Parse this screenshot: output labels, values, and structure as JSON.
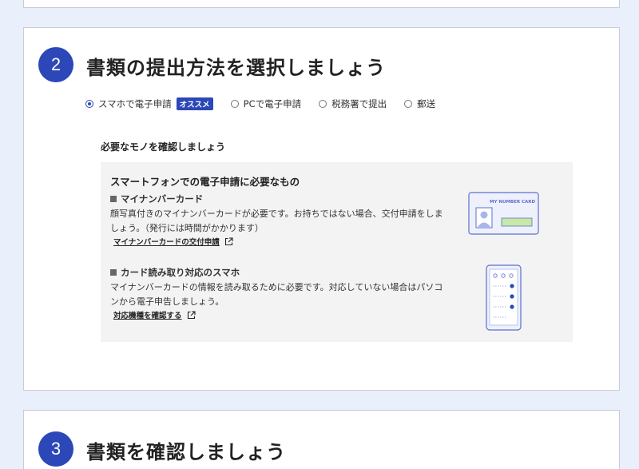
{
  "step2": {
    "number": "2",
    "title": "書類の提出方法を選択しましょう",
    "options": [
      {
        "label": "スマホで電子申請",
        "badge": "オススメ",
        "selected": true
      },
      {
        "label": "PCで電子申請",
        "selected": false
      },
      {
        "label": "税務署で提出",
        "selected": false
      },
      {
        "label": "郵送",
        "selected": false
      }
    ],
    "needs_title": "必要なモノを確認しましょう",
    "box_title": "スマートフォンでの電子申請に必要なもの",
    "items": [
      {
        "head": "マイナンバーカード",
        "desc": "顔写真付きのマイナンバーカードが必要です。お持ちではない場合、交付申請をしましょう。（発行には時間がかかります）",
        "link": "マイナンバーカードの交付申請",
        "illus_text": "MY NUMBER CARD"
      },
      {
        "head": "カード読み取り対応のスマホ",
        "desc": "マイナンバーカードの情報を読み取るために必要です。対応していない場合はパソコンから電子申告しましょう。",
        "link": "対応機種を確認する"
      }
    ]
  },
  "step3": {
    "number": "3",
    "title": "書類を確認しましょう"
  },
  "colors": {
    "accent": "#2b47b8",
    "background": "#eaf0fb",
    "box": "#f4f3f4"
  }
}
